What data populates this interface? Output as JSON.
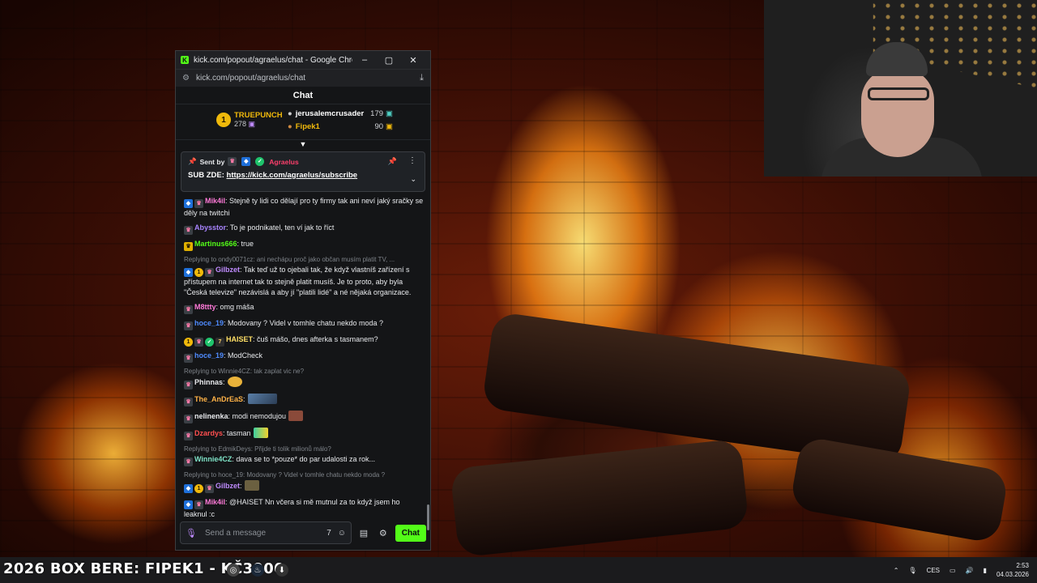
{
  "window": {
    "title": "kick.com/popout/agraelus/chat - Google Chrome",
    "url": "kick.com/popout/agraelus/chat",
    "min_icon": "minimize-icon",
    "max_icon": "maximize-icon",
    "close_icon": "close-icon"
  },
  "chat": {
    "header": "Chat",
    "leaderboard": {
      "first": {
        "rank": "1",
        "name": "TRUEPUNCH",
        "value": "278"
      },
      "second": {
        "name": "jerusalemcrusader",
        "value": "179"
      },
      "third": {
        "name": "Fipek1",
        "value": "90"
      }
    },
    "pinned": {
      "sent_by": "Sent by",
      "sender": "Agraelus",
      "text_prefix": "SUB ZDE:",
      "link": "https://kick.com/agraelus/subscribe"
    },
    "messages": [
      {
        "user": "Mik4il",
        "color": "#ff7ad9",
        "text": ": Stejně ty lidi co dělají pro ty firmy tak ani neví jaký sračky se děly na twitchi"
      },
      {
        "user": "Abysstor",
        "color": "#a884ff",
        "text": ": To je podnikatel, ten ví jak to říct"
      },
      {
        "user": "Martinus666",
        "color": "#53fc18",
        "text": ": true"
      },
      {
        "reply": "Replying to ondy0071cz: ani nechápu proč jako občan musím platit TV, ...",
        "user": "Gilbzet",
        "color": "#c08cff",
        "text": ": Tak teď už to ojebali tak, že když vlastníš zařízení s přístupem na internet tak to stejně platit musíš. Je to proto, aby byla \"Česká televize\" nezávislá a aby jí \"platili lidé\" a né nějaká organizace."
      },
      {
        "user": "M8ttty",
        "color": "#ff7ad9",
        "text": ": omg máša"
      },
      {
        "user": "hoce_19",
        "color": "#4f8cff",
        "text": ": Modovany ? Videl v tomhle chatu nekdo moda ?"
      },
      {
        "user": "HAISET",
        "color": "#ffe066",
        "text": ": čuš mášo, dnes afterka s tasmanem?"
      },
      {
        "user": "hoce_19",
        "color": "#4f8cff",
        "text": ": ModCheck"
      },
      {
        "reply": "Replying to Winnie4CZ: tak zaplat vic ne?",
        "user": "Phinnas",
        "color": "#e8eaed",
        "text": ":"
      },
      {
        "user": "The_AnDrEaS",
        "color": "#ffb347",
        "text": ":"
      },
      {
        "user": "nelinenka",
        "color": "#e8eaed",
        "text": ": modi nemodujou"
      },
      {
        "user": "Dzardys",
        "color": "#ff4f4f",
        "text": ": tasman"
      },
      {
        "reply": "Replying to EdmikDeys: Přijde ti tolik milionů málo?",
        "user": "Winnie4CZ",
        "color": "#7fe3c7",
        "text": ": dava se to *pouze* do par udalosti za rok..."
      },
      {
        "reply": "Replying to hoce_19: Modovany ? Videl v tomhle chatu nekdo moda ?",
        "user": "Gilbzet",
        "color": "#c08cff",
        "text": ":"
      },
      {
        "user": "Mik4il",
        "color": "#ff7ad9",
        "text": ": @HAISET Nn včera si mě mutnul za to když jsem ho leaknul :c"
      }
    ],
    "input_placeholder": "Send a message",
    "send_label": "Chat"
  },
  "taskbar": {
    "ticker": "2026 BOX BERE: FIPEK1 - KČ3900",
    "language": "CES",
    "time": "2:53",
    "date": "04.03.2026"
  },
  "colors": {
    "kick_green": "#53fc18",
    "gold": "#f0b90b"
  }
}
